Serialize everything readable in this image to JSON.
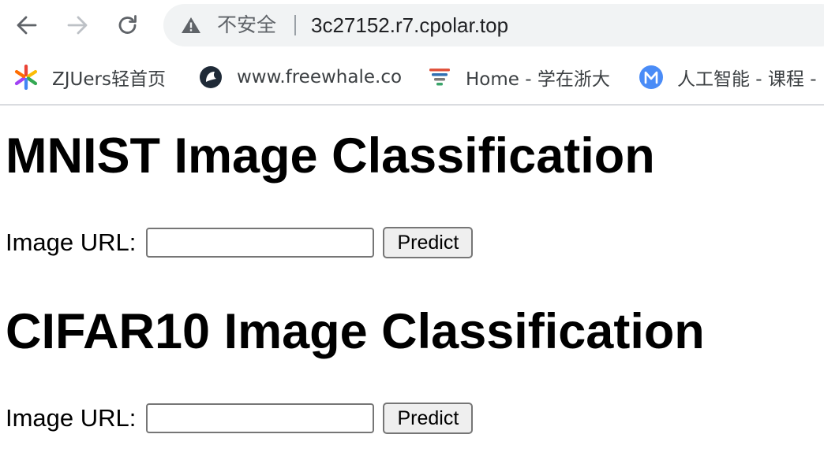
{
  "browser": {
    "security_label": "不安全",
    "url": "3c27152.r7.cpolar.top"
  },
  "bookmarks": [
    {
      "label": "ZJUers轻首页",
      "icon": "pinwheel-icon"
    },
    {
      "label": "www.freewhale.co",
      "icon": "whale-icon"
    },
    {
      "label": "Home - 学在浙大",
      "icon": "tornado-icon"
    },
    {
      "label": "人工智能 - 课程 -",
      "icon": "m-badge-icon"
    }
  ],
  "page": {
    "sections": [
      {
        "title": "MNIST Image Classification",
        "field_label": "Image URL:",
        "input_value": "",
        "button_label": "Predict"
      },
      {
        "title": "CIFAR10 Image Classification",
        "field_label": "Image URL:",
        "input_value": "",
        "button_label": "Predict"
      }
    ]
  },
  "colors": {
    "omnibox_bg": "#f1f3f4",
    "icon_gray": "#5f6368",
    "disabled_gray": "#bdc1c6",
    "m_badge_blue": "#4a8cf7"
  }
}
